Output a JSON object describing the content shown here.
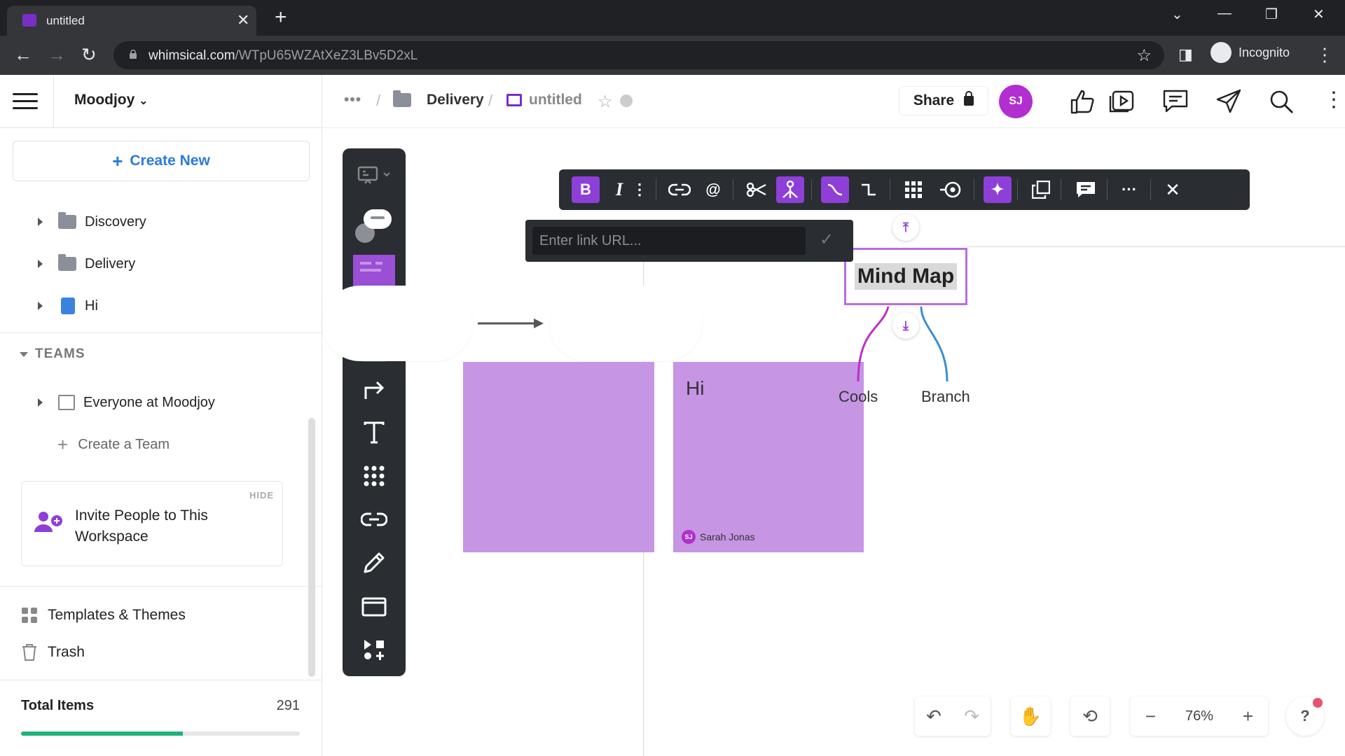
{
  "browser": {
    "tab_title": "untitled",
    "url_host": "whimsical.com",
    "url_path": "/WTpU65WZAtXeZ3LBv5D2xL",
    "incognito_label": "Incognito"
  },
  "sidebar": {
    "workspace": "Moodjoy",
    "create_new": "Create New",
    "folders": [
      {
        "label": "Discovery",
        "type": "folder"
      },
      {
        "label": "Delivery",
        "type": "folder"
      },
      {
        "label": "Hi",
        "type": "doc"
      }
    ],
    "teams_header": "TEAMS",
    "team": "Everyone at Moodjoy",
    "create_team": "Create a Team",
    "invite": {
      "hide": "HIDE",
      "text": "Invite People to This Workspace"
    },
    "templates": "Templates & Themes",
    "trash": "Trash",
    "total_label": "Total Items",
    "total_count": "291",
    "usage_fraction": 0.58
  },
  "topbar": {
    "more": "•••",
    "folder": "Delivery",
    "board": "untitled",
    "share": "Share",
    "avatar": "SJ"
  },
  "link_popup": {
    "placeholder": "Enter link URL..."
  },
  "board": {
    "sticky_2_text": "Hi",
    "sticky_author": "Sarah Jonas",
    "sticky_author_initials": "SJ",
    "mindmap_root": "Mind Map",
    "branches": [
      "Cools",
      "Branch"
    ]
  },
  "bottom": {
    "zoom": "76%",
    "help": "?"
  },
  "colors": {
    "accent": "#8e3fd8",
    "sticky": "#c695e4",
    "link": "#2b7bd9",
    "progress": "#1fb27a"
  }
}
